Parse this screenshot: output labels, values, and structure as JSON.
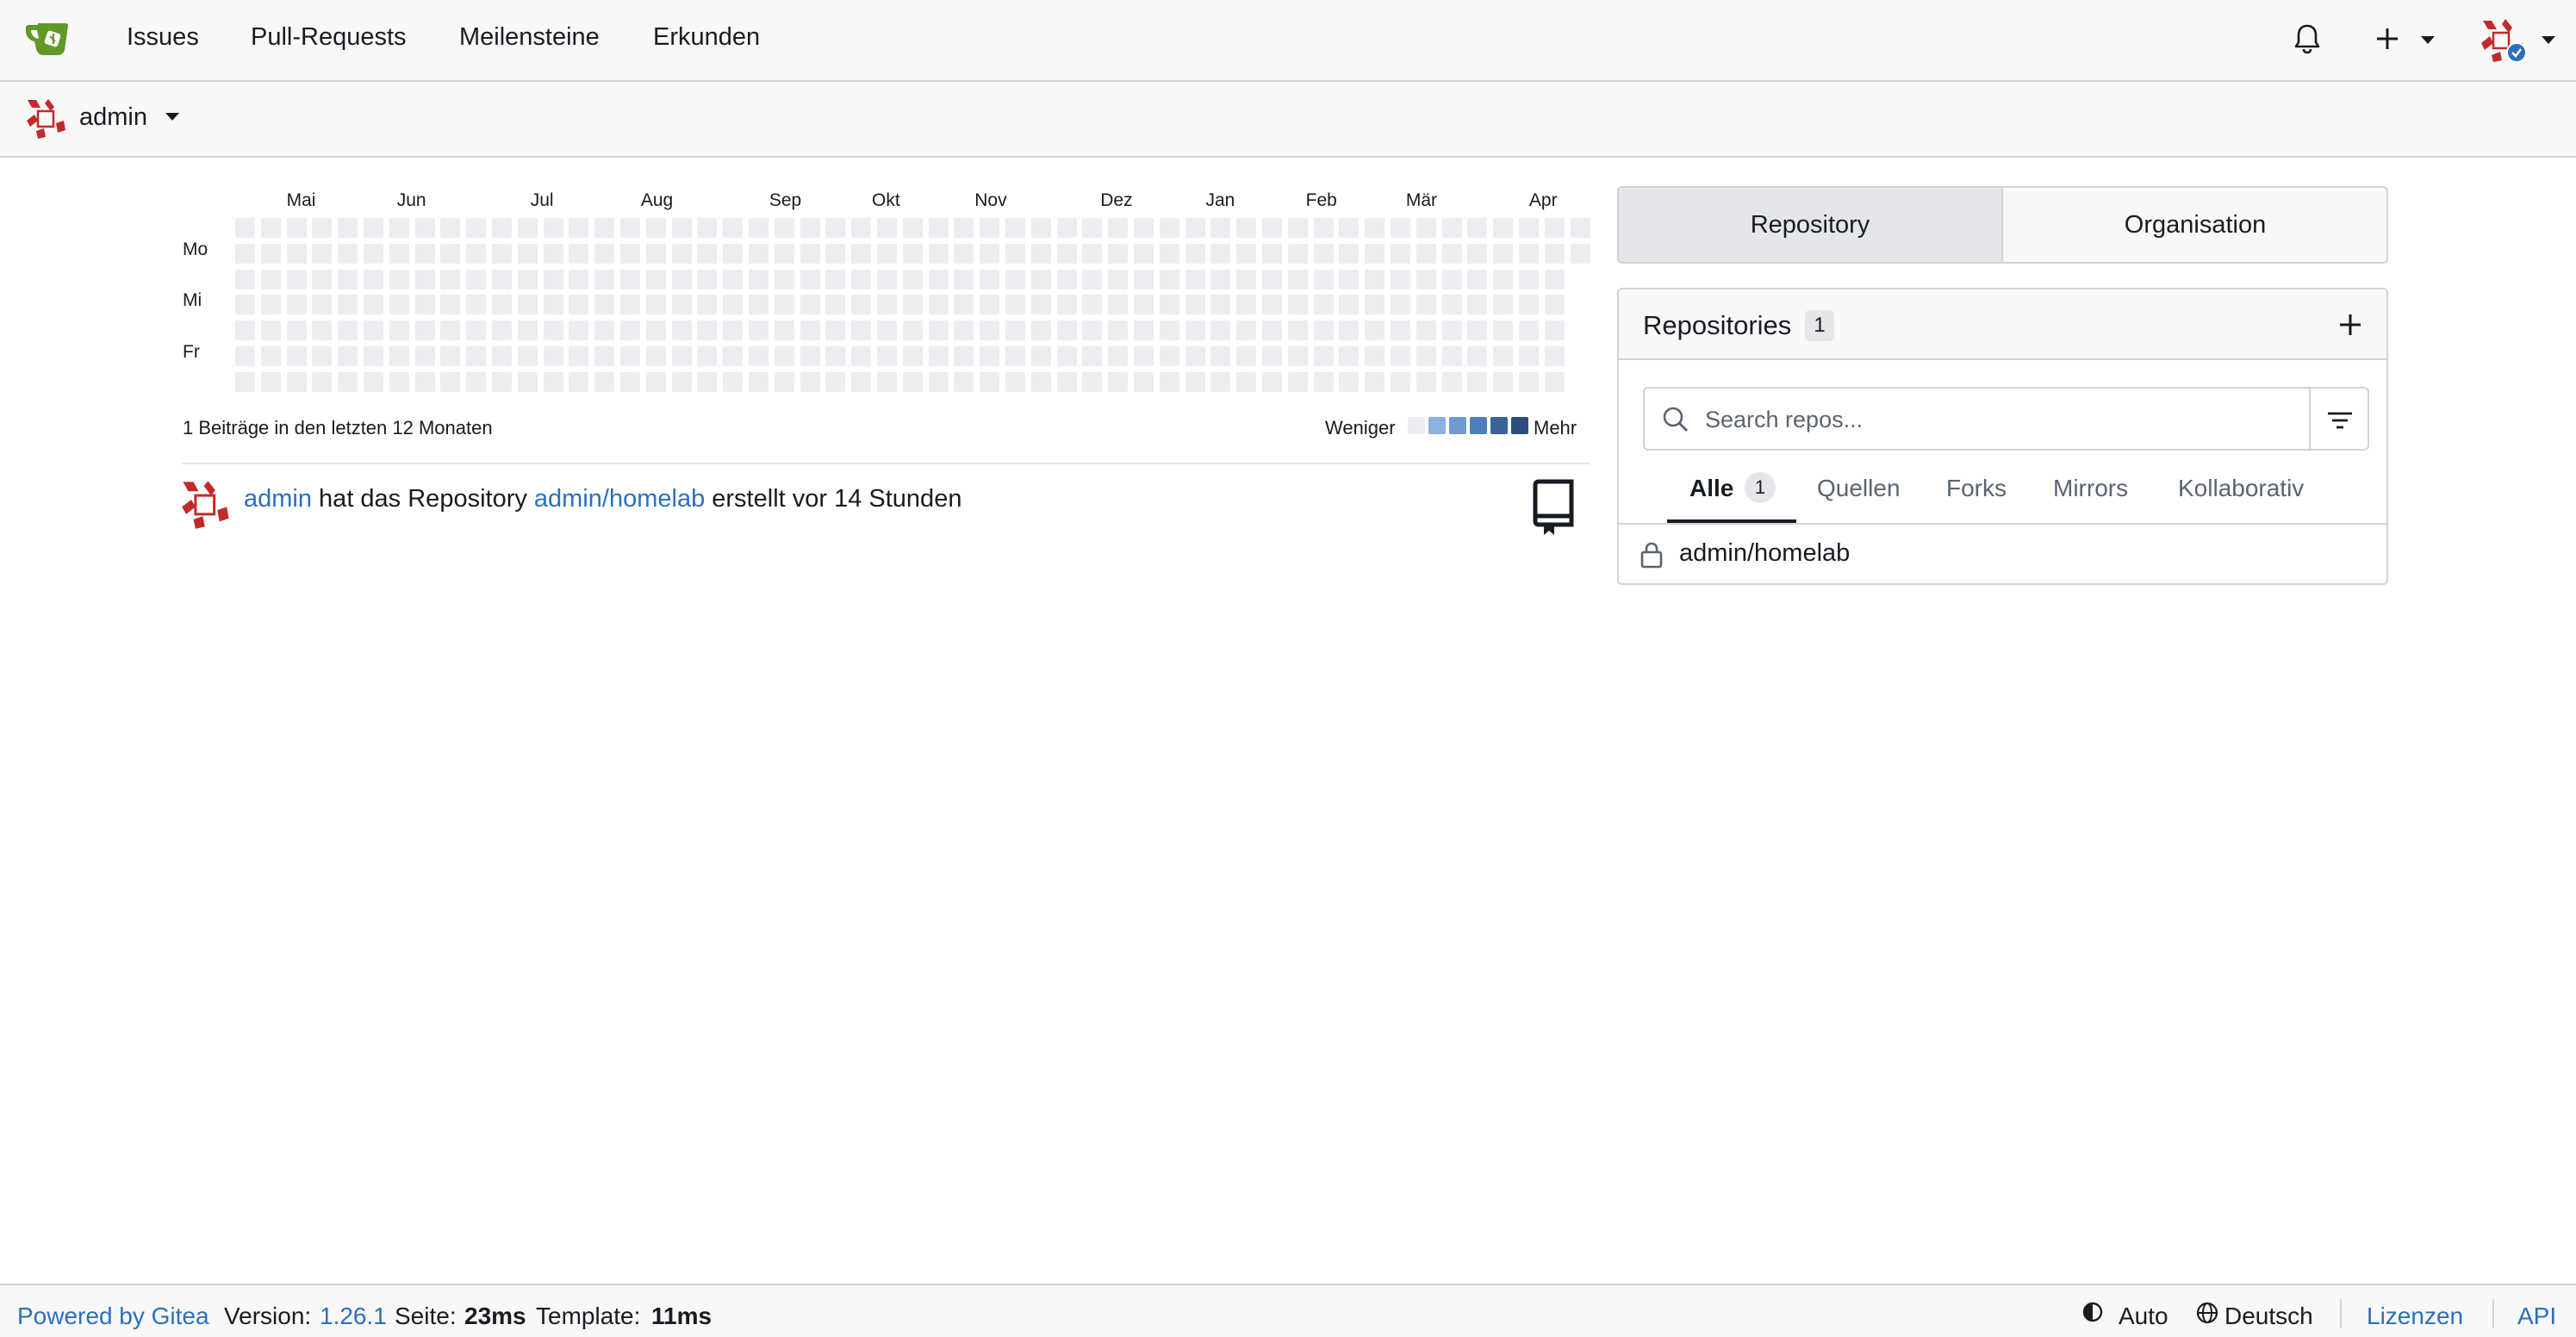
{
  "nav": {
    "links": [
      "Issues",
      "Pull-Requests",
      "Meilensteine",
      "Erkunden"
    ]
  },
  "context": {
    "user": "admin"
  },
  "heatmap": {
    "months": [
      "Mai",
      "Jun",
      "Jul",
      "Aug",
      "Sep",
      "Okt",
      "Nov",
      "Dez",
      "Jan",
      "Feb",
      "Mär",
      "Apr"
    ],
    "days": [
      "Mo",
      "Mi",
      "Fr"
    ],
    "contributions_text": "1 Beiträge in den letzten 12 Monaten",
    "legend_less": "Weniger",
    "legend_more": "Mehr",
    "active_cell": {
      "week": 52,
      "day": 2,
      "level": 4
    },
    "colors": [
      "#ebedf0",
      "#c8d8ee",
      "#8eb0dd",
      "#5b8cc7",
      "#3f6ea6",
      "#2a4f7e"
    ]
  },
  "feed": {
    "user": "admin",
    "text_mid": " hat das Repository ",
    "repo": "admin/homelab",
    "text_end": " erstellt vor 14 Stunden"
  },
  "panel": {
    "switch_tabs": [
      "Repository",
      "Organisation"
    ],
    "title": "Repositories",
    "count": "1",
    "search_placeholder": "Search repos...",
    "tabs": [
      {
        "label": "Alle",
        "count": "1"
      },
      {
        "label": "Quellen"
      },
      {
        "label": "Forks"
      },
      {
        "label": "Mirrors"
      },
      {
        "label": "Kollaborativ"
      }
    ],
    "repos": [
      "admin/homelab"
    ]
  },
  "footer": {
    "powered": "Powered by Gitea",
    "version_label": "Version:",
    "version": "1.26.1",
    "page_label": "Seite:",
    "page_time": "23ms",
    "template_label": "Template:",
    "template_time": "11ms",
    "theme": "Auto",
    "language": "Deutsch",
    "licenses": "Lizenzen",
    "api": "API"
  },
  "colors": {
    "accent": "#2c6fbd",
    "brand": "#609926"
  }
}
